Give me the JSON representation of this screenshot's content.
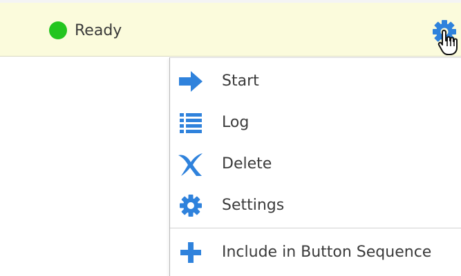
{
  "status": {
    "state_label": "Ready",
    "indicator_color": "#23c51f",
    "indicator_icon": "status-dot-icon"
  },
  "toolbar": {
    "settings_icon": "gear-icon"
  },
  "menu": {
    "items": [
      {
        "label": "Start",
        "icon": "arrow-right-icon"
      },
      {
        "label": "Log",
        "icon": "list-icon"
      },
      {
        "label": "Delete",
        "icon": "delete-x-icon"
      },
      {
        "label": "Settings",
        "icon": "gear-icon"
      }
    ],
    "extra_items": [
      {
        "label": "Include in Button Sequence",
        "icon": "plus-icon"
      }
    ]
  },
  "colors": {
    "status_bar_bg": "#fbfbdc",
    "icon_blue": "#2f82dc",
    "text": "#3a3a3a"
  }
}
